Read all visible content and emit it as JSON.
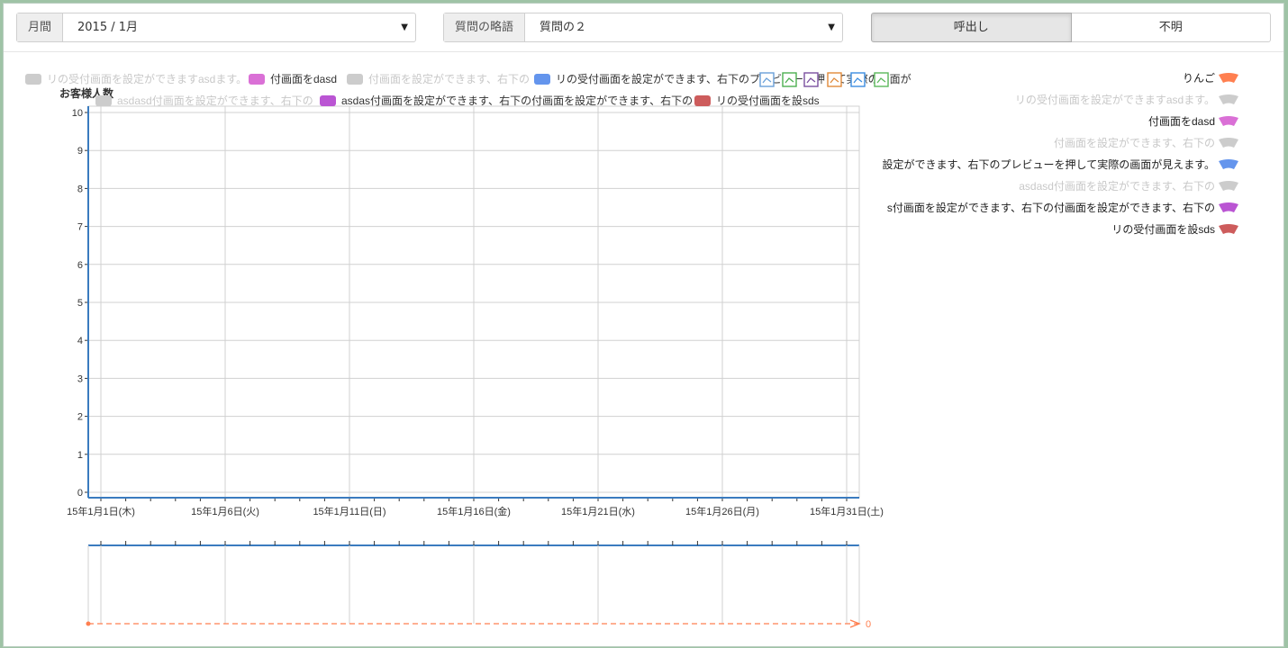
{
  "filters": {
    "month": {
      "label": "月間",
      "value": "2015 / 1月"
    },
    "question": {
      "label": "質問の略語",
      "value": "質問の２"
    }
  },
  "toggle": {
    "call_label": "呼出し",
    "unknown_label": "不明"
  },
  "colors": {
    "axis": "#3a7bbf",
    "grid": "#d0d0d0",
    "inactive": "#cccccc",
    "nav_line": "#ff7f50"
  },
  "chart_data": {
    "type": "line",
    "ylabel": "お客様人数",
    "ylim": [
      0,
      10
    ],
    "yticks": [
      "0",
      "1",
      "2",
      "3",
      "4",
      "5",
      "6",
      "7",
      "8",
      "9",
      "10"
    ],
    "xlim": [
      "2015-01-01",
      "2015-01-31"
    ],
    "xtick_labels": [
      "15年1月1日(木)",
      "15年1月6日(火)",
      "15年1月11日(日)",
      "15年1月16日(金)",
      "15年1月21日(水)",
      "15年1月26日(月)",
      "15年1月31日(土)"
    ],
    "top_legend": [
      {
        "text": "リの受付画面を設定ができますasdます。",
        "color": "#cccccc",
        "active": false
      },
      {
        "text": "付画面をdasd",
        "color": "#da70d6",
        "active": true
      },
      {
        "text": "付画面を設定ができます、右下の",
        "color": "#cccccc",
        "active": false
      },
      {
        "text": "リの受付画面を設定ができます、右下のプレビューを押して実際の画面が",
        "color": "#6495ed",
        "active": true
      },
      {
        "text": "asdasd付画面を設定ができます、右下の",
        "color": "#cccccc",
        "active": false
      },
      {
        "text": "asdas付画面を設定ができます、右下の付画面を設定ができます、右下の",
        "color": "#ba55d3",
        "active": true
      },
      {
        "text": "リの受付画面を設sds",
        "color": "#cd5c5c",
        "active": true
      }
    ],
    "series": [
      {
        "name": "りんご",
        "color": "#ff7f50",
        "active": true,
        "values": [
          0
        ]
      },
      {
        "name": "リの受付画面を設定ができますasdます。",
        "color": "#cccccc",
        "active": false,
        "values": []
      },
      {
        "name": "付画面をdasd",
        "color": "#da70d6",
        "active": true,
        "values": []
      },
      {
        "name": "付画面を設定ができます、右下の",
        "color": "#cccccc",
        "active": false,
        "values": []
      },
      {
        "name": "設定ができます、右下のプレビューを押して実際の画面が見えます。",
        "color": "#6495ed",
        "active": true,
        "values": []
      },
      {
        "name": "asdasd付画面を設定ができます、右下の",
        "color": "#cccccc",
        "active": false,
        "values": []
      },
      {
        "name": "s付画面を設定ができます、右下の付画面を設定ができます、右下の",
        "color": "#ba55d3",
        "active": true,
        "values": []
      },
      {
        "name": "リの受付画面を設sds",
        "color": "#cd5c5c",
        "active": true,
        "values": []
      }
    ],
    "navigator_end_label": "0",
    "grid": true
  }
}
